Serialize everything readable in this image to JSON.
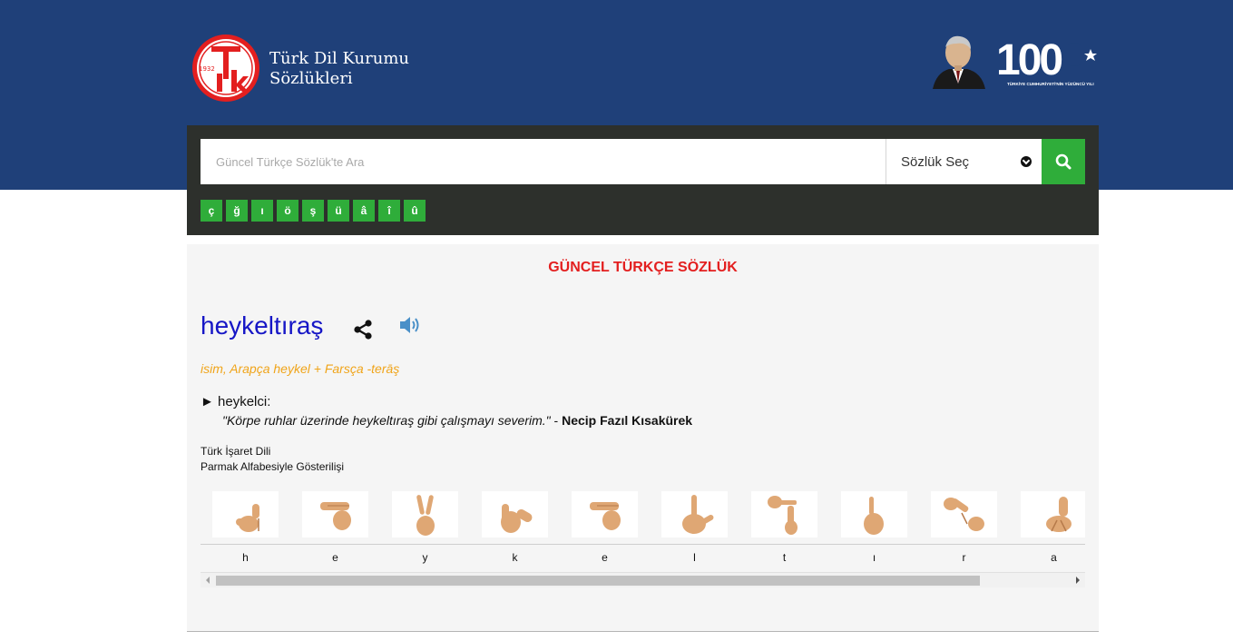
{
  "header": {
    "logo_year": "1932",
    "brand_line1": "Türk Dil Kurumu",
    "brand_line2": "Sözlükleri",
    "centennial_text": "TÜRKİYE CUMHURİYETİ'NİN YÜZÜNCÜ YILI"
  },
  "search": {
    "placeholder": "Güncel Türkçe Sözlük'te Ara",
    "dictionary_select": "Sözlük Seç",
    "special_letters": [
      "ç",
      "ğ",
      "ı",
      "ö",
      "ş",
      "ü",
      "â",
      "î",
      "û"
    ]
  },
  "entry": {
    "dictionary_title": "GÜNCEL TÜRKÇE SÖZLÜK",
    "word": "heykeltıraş",
    "grammar": "isim, Arapça heykel + Farsça -terāş",
    "meaning": "► heykelci:",
    "example_text": "\"Körpe ruhlar üzerinde heykeltıraş gibi çalışmayı severim.\"",
    "example_sep": " - ",
    "example_author": "Necip Fazıl Kısakürek"
  },
  "sign_language": {
    "title_line1": "Türk İşaret Dili",
    "title_line2": "Parmak Alfabesiyle Gösterilişi",
    "letters": [
      "h",
      "e",
      "y",
      "k",
      "e",
      "l",
      "t",
      "ı",
      "r",
      "a"
    ],
    "scroll_position": 0.0
  },
  "colors": {
    "header_bg": "#1f4079",
    "search_panel_bg": "#2d302c",
    "accent_green": "#2fad3a",
    "title_red": "#e31f1f",
    "word_blue": "#1616c6",
    "grammar_orange": "#f0a419",
    "skin": "#dfa774"
  },
  "icons": {
    "share": "share-icon",
    "sound": "speaker-icon",
    "search": "search-icon",
    "select": "chevron-down-icon"
  }
}
